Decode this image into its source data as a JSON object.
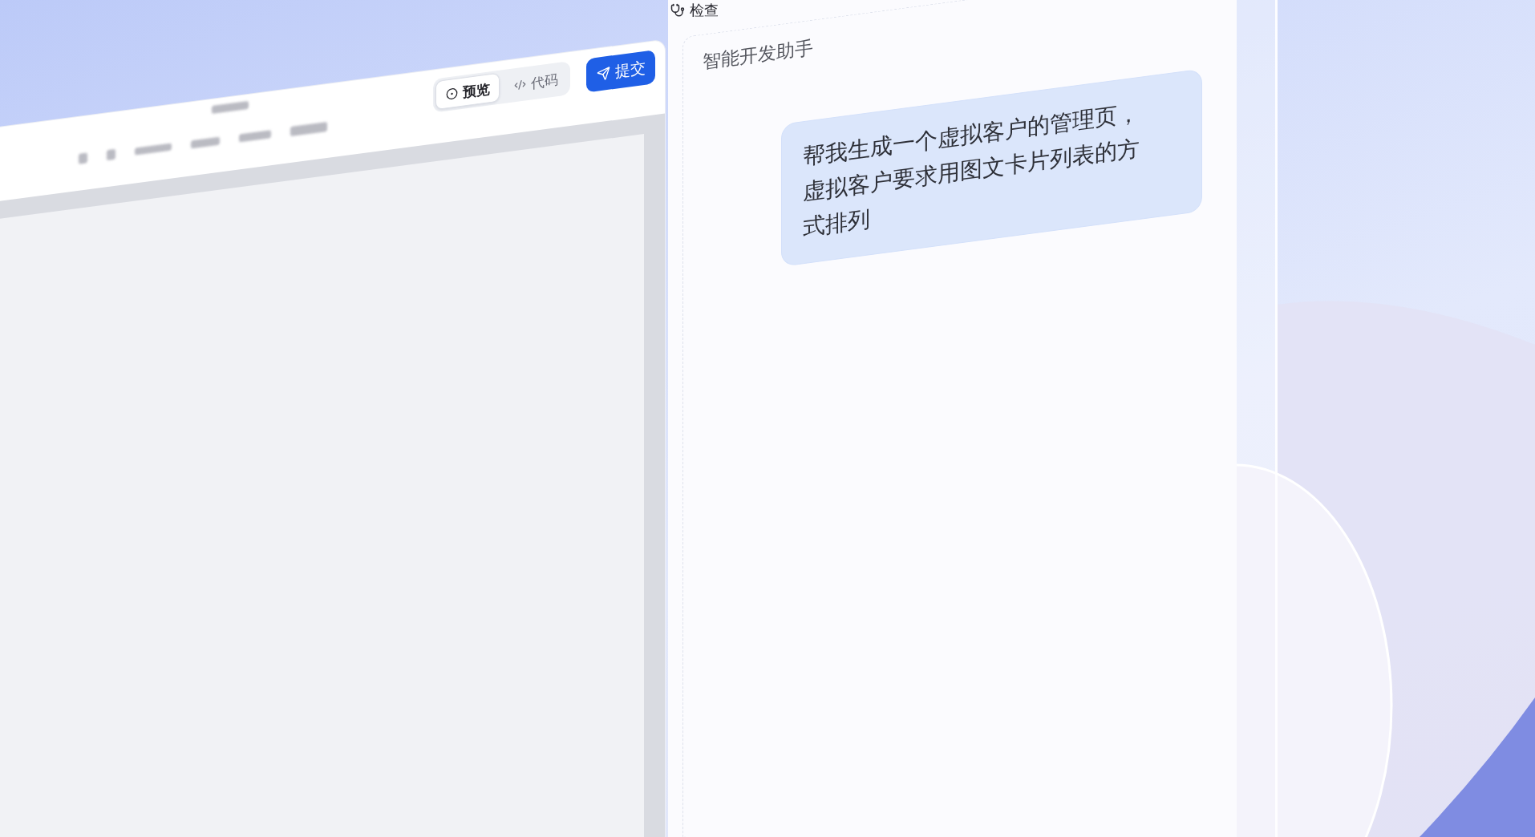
{
  "top_bar": {
    "item": {
      "label": "检查"
    }
  },
  "editor": {
    "toolbar": {
      "view_tabs": [
        {
          "label": "预览",
          "selected": true
        },
        {
          "label": "代码",
          "selected": false
        }
      ],
      "submit_button": {
        "label": "提交"
      }
    }
  },
  "assistant": {
    "title": "智能开发助手",
    "messages": [
      {
        "kind": "user",
        "text": "帮我生成一个虚拟客户的管理页，虚拟客户要求用图文卡片列表的方式排列"
      }
    ]
  }
}
